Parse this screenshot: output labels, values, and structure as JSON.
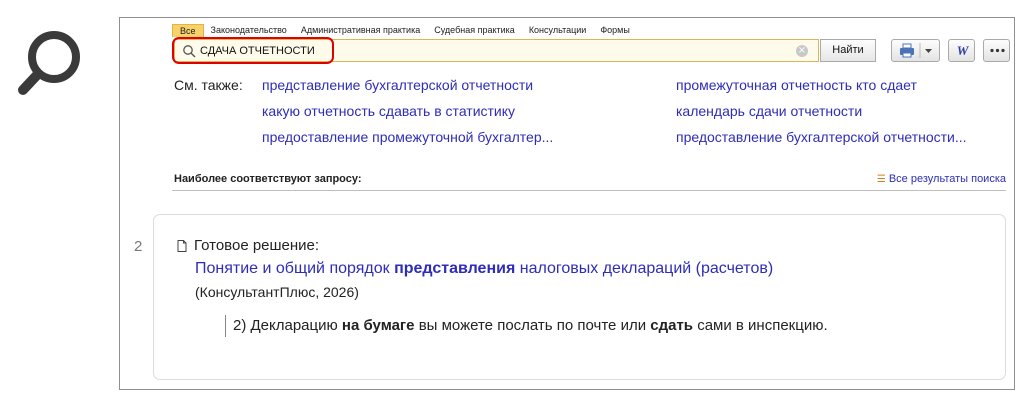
{
  "tabs": [
    "Все",
    "Законодательство",
    "Административная практика",
    "Судебная практика",
    "Консультации",
    "Формы"
  ],
  "active_tab": "Все",
  "search": {
    "value": "СДАЧА ОТЧЕТНОСТИ"
  },
  "find_label": "Найти",
  "see_also": {
    "label": "См. также:",
    "links": [
      "представление бухгалтерской отчетности",
      "промежуточная отчетность кто сдает",
      "какую отчетность сдавать в статистику",
      "календарь сдачи отчетности",
      "предоставление промежуточной бухгалтер...",
      "предоставление бухгалтерской отчетности..."
    ]
  },
  "section_title": "Наиболее соответствуют запросу:",
  "all_results_label": "Все результаты поиска",
  "result": {
    "number": "2",
    "type": "Готовое решение:",
    "title_pre": "Понятие и общий порядок ",
    "title_bold": "представления",
    "title_post": " налоговых деклараций (расчетов)",
    "source": "(КонсультантПлюс, 2026)",
    "snippet_1": "2) Декларацию ",
    "snippet_bold_1": "на бумаге",
    "snippet_2": " вы можете послать по почте или ",
    "snippet_bold_2": "сдать",
    "snippet_3": " сами в инспекцию."
  },
  "icons": {
    "app": "magnifier-icon",
    "search": "search-icon",
    "clear": "clear-icon",
    "print": "printer-icon",
    "word": "word-icon",
    "more": "more-icon",
    "doc": "document-icon",
    "all_results": "list-icon"
  },
  "colors": {
    "link": "#2d2db8",
    "highlight": "#e00000",
    "tab_active": "#f6d36a"
  }
}
